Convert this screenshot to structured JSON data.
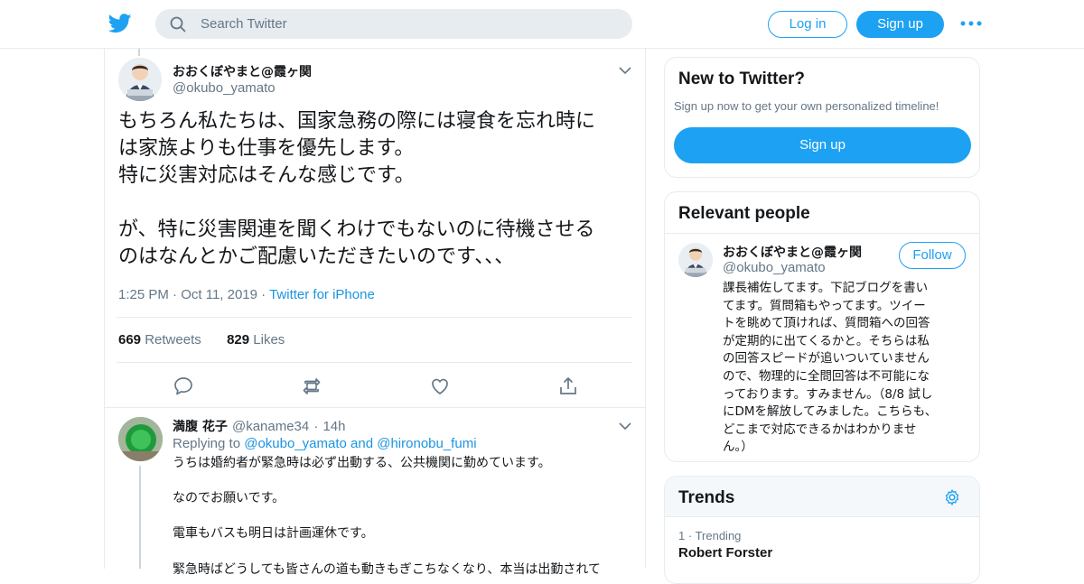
{
  "header": {
    "search_placeholder": "Search Twitter",
    "login_label": "Log in",
    "signup_label": "Sign up"
  },
  "tweet": {
    "author_name": "おおくぼやまと@霞ヶ関",
    "author_handle": "@okubo_yamato",
    "text": "もちろん私たちは、国家急務の際には寝食を忘れ時に\nは家族よりも仕事を優先します。\n特に災害対応はそんな感じです。\n\nが、特に災害関連を聞くわけでもないのに待機させる\nのはなんとかご配慮いただきたいのです、、、",
    "time": "1:25 PM",
    "date": "Oct 11, 2019",
    "source": "Twitter for iPhone",
    "retweets_count": "669",
    "retweets_label": "Retweets",
    "likes_count": "829",
    "likes_label": "Likes"
  },
  "reply": {
    "author_name": "満腹 花子",
    "author_handle": "@kaname34",
    "age": "14h",
    "replying_prefix": "Replying to",
    "replying_user1": "@okubo_yamato",
    "replying_and": "and",
    "replying_user2": "@hironobu_fumi",
    "text": "うちは婚約者が緊急時は必ず出動する、公共機関に勤めています。\n\nなのでお願いです。\n\n電車もバスも明日は計画運休です。\n\n緊急時ばどうしても皆さんの道も動きもぎこちなくなり、本当は出勤されて"
  },
  "new_to_twitter": {
    "title": "New to Twitter?",
    "subtitle": "Sign up now to get your own personalized timeline!",
    "signup_label": "Sign up"
  },
  "relevant_people": {
    "title": "Relevant people",
    "name": "おおくぼやまと@霞ヶ関",
    "handle": "@okubo_yamato",
    "follow_label": "Follow",
    "bio": "課長補佐してます。下記ブログを書い\nてます。質問箱もやってます。ツイー\nトを眺めて頂ければ、質問箱への回答\nが定期的に出てくるかと。そちらは私\nの回答スピードが追いついていません\nので、物理的に全問回答は不可能にな\nっております。すみません。（8/8 試し\nにDMを解放してみました。こちらも、\nどこまで対応できるかはわかりませ\nん。）"
  },
  "trends": {
    "title": "Trends",
    "items": [
      {
        "rank": "1",
        "meta": "Trending",
        "name": "Robert Forster"
      }
    ]
  },
  "colors": {
    "accent": "#1da1f2",
    "link": "#1b95e0",
    "secondary_text": "#657786",
    "border": "#e6ecf0"
  }
}
